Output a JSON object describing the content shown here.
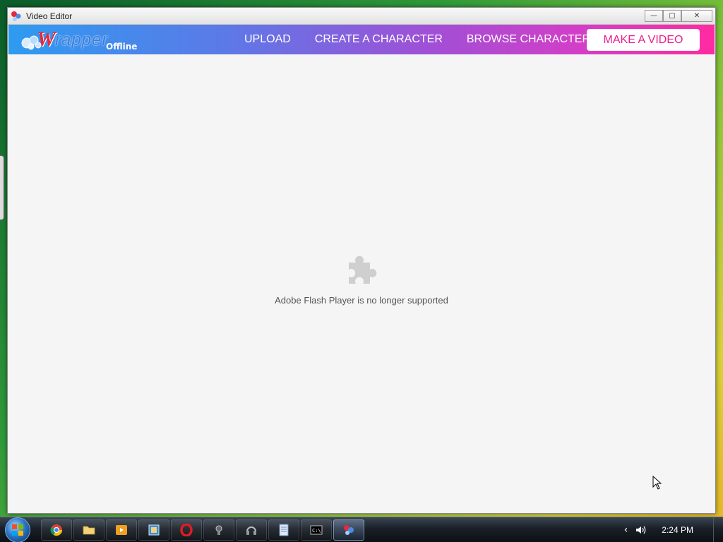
{
  "window": {
    "title": "Video Editor",
    "controls": {
      "minimize": "—",
      "maximize": "▢",
      "close": "✕"
    }
  },
  "navbar": {
    "logo": {
      "w": "W",
      "rapper": "rapper",
      "offline": "Offline"
    },
    "links": [
      "UPLOAD",
      "CREATE A CHARACTER",
      "BROWSE CHARACTERS"
    ],
    "cta": "MAKE A VIDEO",
    "cta_color": "#e81e8c"
  },
  "content": {
    "plugin_icon": "puzzle-piece-icon",
    "message": "Adobe Flash Player is no longer supported"
  },
  "taskbar": {
    "items": [
      "chrome-icon",
      "folder-icon",
      "media-player-icon",
      "photo-icon",
      "opera-icon",
      "camera-icon",
      "headset-icon",
      "document-icon",
      "command-prompt-icon",
      "wrapper-app-icon"
    ],
    "active_index": 9,
    "tray_arrow": "‹",
    "clock": "2:24 PM"
  }
}
